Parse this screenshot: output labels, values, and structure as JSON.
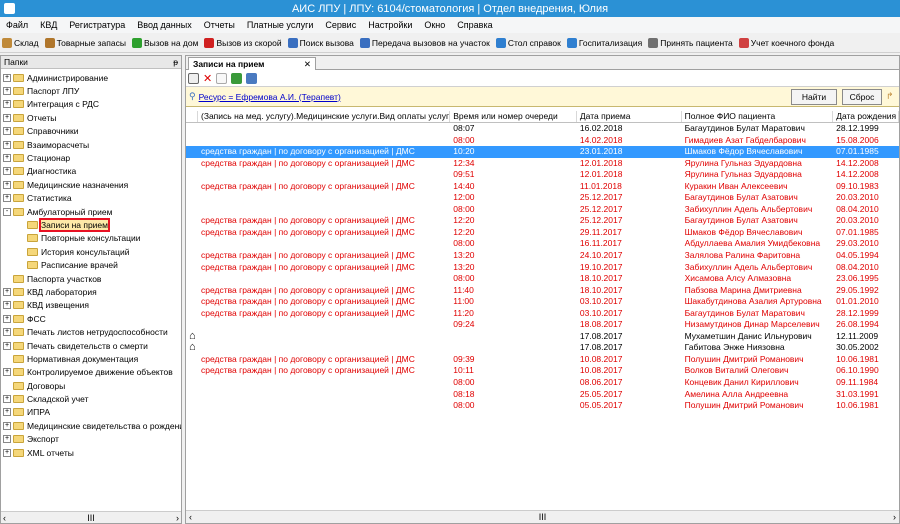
{
  "window": {
    "title": "АИС ЛПУ | ЛПУ: 6104/стоматология | Отдел внедрения, Юлия"
  },
  "menu": [
    "Файл",
    "КВД",
    "Регистратура",
    "Ввод данных",
    "Отчеты",
    "Платные услуги",
    "Сервис",
    "Настройки",
    "Окно",
    "Справка"
  ],
  "toolbar": [
    {
      "label": "Склад",
      "icon": "warehouse-icon",
      "color": "#c08a3a"
    },
    {
      "label": "Товарные запасы",
      "icon": "stock-icon",
      "color": "#b0762b"
    },
    {
      "label": "Вызов на дом",
      "icon": "home-call-icon",
      "color": "#2ea02e"
    },
    {
      "label": "Вызов из скорой",
      "icon": "ambulance-call-icon",
      "color": "#d02020"
    },
    {
      "label": "Поиск вызова",
      "icon": "search-call-icon",
      "color": "#3a6fc0"
    },
    {
      "label": "Передача вызовов на участок",
      "icon": "transfer-call-icon",
      "color": "#3a6fc0"
    },
    {
      "label": "Стол справок",
      "icon": "info-desk-icon",
      "color": "#2f7fd0"
    },
    {
      "label": "Госпитализация",
      "icon": "hospitalization-icon",
      "color": "#2f7fd0"
    },
    {
      "label": "Принять пациента",
      "icon": "accept-patient-icon",
      "color": "#707070"
    },
    {
      "label": "Учет коечного фонда",
      "icon": "bed-fund-icon",
      "color": "#d04040"
    }
  ],
  "left_panel": {
    "title": "Папки",
    "pin": "ᵽ",
    "tree": [
      {
        "label": "Администрирование",
        "level": 0,
        "expander": "+"
      },
      {
        "label": "Паспорт ЛПУ",
        "level": 0,
        "expander": "+"
      },
      {
        "label": "Интеграция с РДС",
        "level": 0,
        "expander": "+"
      },
      {
        "label": "Отчеты",
        "level": 0,
        "expander": "+"
      },
      {
        "label": "Справочники",
        "level": 0,
        "expander": "+"
      },
      {
        "label": "Взаиморасчеты",
        "level": 0,
        "expander": "+"
      },
      {
        "label": "Стационар",
        "level": 0,
        "expander": "+"
      },
      {
        "label": "Диагностика",
        "level": 0,
        "expander": "+"
      },
      {
        "label": "Медицинские назначения",
        "level": 0,
        "expander": "+"
      },
      {
        "label": "Статистика",
        "level": 0,
        "expander": "+"
      },
      {
        "label": "Амбулаторный прием",
        "level": 0,
        "expander": "-"
      },
      {
        "label": "Записи на прием",
        "level": 1,
        "expander": "",
        "selected": true
      },
      {
        "label": "Повторные консультации",
        "level": 1,
        "expander": ""
      },
      {
        "label": "История консультаций",
        "level": 1,
        "expander": ""
      },
      {
        "label": "Расписание врачей",
        "level": 1,
        "expander": ""
      },
      {
        "label": "Паспорта участков",
        "level": 0,
        "expander": ""
      },
      {
        "label": "КВД лаборатория",
        "level": 0,
        "expander": "+"
      },
      {
        "label": "КВД извещения",
        "level": 0,
        "expander": "+"
      },
      {
        "label": "ФСС",
        "level": 0,
        "expander": "+"
      },
      {
        "label": "Печать листов нетрудоспособности",
        "level": 0,
        "expander": "+"
      },
      {
        "label": "Печать свидетельств о смерти",
        "level": 0,
        "expander": "+"
      },
      {
        "label": "Нормативная документация",
        "level": 0,
        "expander": ""
      },
      {
        "label": "Контролируемое движение объектов",
        "level": 0,
        "expander": "+"
      },
      {
        "label": "Договоры",
        "level": 0,
        "expander": ""
      },
      {
        "label": "Складской учет",
        "level": 0,
        "expander": "+"
      },
      {
        "label": "ИПРА",
        "level": 0,
        "expander": "+"
      },
      {
        "label": "Медицинские свидетельства о рождении",
        "level": 0,
        "expander": "+"
      },
      {
        "label": "Экспорт",
        "level": 0,
        "expander": "+"
      },
      {
        "label": "XML отчеты",
        "level": 0,
        "expander": "+"
      }
    ]
  },
  "main": {
    "tab_title": "Записи на прием",
    "tab_close": "✕",
    "filter": "Ресурс = Ефремова А.И. (Терапевт)",
    "find_button": "Найти",
    "reset_button": "Сброс",
    "columns": [
      "",
      "(Запись на мед. услугу).Медицинские услуги.Вид оплаты услуги",
      "Время или номер очереди",
      "Дата приема",
      "Полное ФИО пациента",
      "Дата рождения"
    ],
    "rows": [
      {
        "icon": "",
        "pay": "",
        "time": "08:07",
        "date": "16.02.2018",
        "name": "Багаутдинов Булат Маратович",
        "dob": "28.12.1999",
        "red": false
      },
      {
        "icon": "",
        "pay": "",
        "time": "08:00",
        "date": "14.02.2018",
        "name": "Гимадиев Азат Габделбарович",
        "dob": "15.08.2006",
        "red": true
      },
      {
        "icon": "",
        "pay": "средства граждан | по договору с организацией | ДМС",
        "time": "10:20",
        "date": "23.01.2018",
        "name": "Шмаков Фёдор Вячеславович",
        "dob": "07.01.1985",
        "red": true,
        "selected": true
      },
      {
        "icon": "",
        "pay": "средства граждан | по договору с организацией | ДМС",
        "time": "12:34",
        "date": "12.01.2018",
        "name": "Ярулина Гульназ Эдуардовна",
        "dob": "14.12.2008",
        "red": true
      },
      {
        "icon": "",
        "pay": "",
        "time": "09:51",
        "date": "12.01.2018",
        "name": "Ярулина Гульназ Эдуардовна",
        "dob": "14.12.2008",
        "red": true
      },
      {
        "icon": "",
        "pay": "средства граждан | по договору с организацией | ДМС",
        "time": "14:40",
        "date": "11.01.2018",
        "name": "Куракин Иван Алексеевич",
        "dob": "09.10.1983",
        "red": true
      },
      {
        "icon": "",
        "pay": "",
        "time": "12:00",
        "date": "25.12.2017",
        "name": "Багаутдинов Булат Азатович",
        "dob": "20.03.2010",
        "red": true
      },
      {
        "icon": "",
        "pay": "",
        "time": "08:00",
        "date": "25.12.2017",
        "name": "Забихуллин Адель Альбертович",
        "dob": "08.04.2010",
        "red": true
      },
      {
        "icon": "",
        "pay": "средства граждан | по договору с организацией | ДМС",
        "time": "12:20",
        "date": "25.12.2017",
        "name": "Багаутдинов Булат Азатович",
        "dob": "20.03.2010",
        "red": true
      },
      {
        "icon": "",
        "pay": "средства граждан | по договору с организацией | ДМС",
        "time": "12:20",
        "date": "29.11.2017",
        "name": "Шмаков Фёдор Вячеславович",
        "dob": "07.01.1985",
        "red": true
      },
      {
        "icon": "",
        "pay": "",
        "time": "08:00",
        "date": "16.11.2017",
        "name": "Абдуллаева Амалия Умидбековна",
        "dob": "29.03.2010",
        "red": true
      },
      {
        "icon": "",
        "pay": "средства граждан | по договору с организацией | ДМС",
        "time": "13:20",
        "date": "24.10.2017",
        "name": "Залялова Ралина Фаритовна",
        "dob": "04.05.1994",
        "red": true
      },
      {
        "icon": "",
        "pay": "средства граждан | по договору с организацией | ДМС",
        "time": "13:20",
        "date": "19.10.2017",
        "name": "Забихуллин Адель Альбертович",
        "dob": "08.04.2010",
        "red": true
      },
      {
        "icon": "",
        "pay": "",
        "time": "08:00",
        "date": "18.10.2017",
        "name": "Хисамова Алсу Алмазовна",
        "dob": "23.06.1995",
        "red": true
      },
      {
        "icon": "",
        "pay": "средства граждан | по договору с организацией | ДМС",
        "time": "11:40",
        "date": "18.10.2017",
        "name": "Пабзова Марина Дмитриевна",
        "dob": "29.05.1992",
        "red": true
      },
      {
        "icon": "",
        "pay": "средства граждан | по договору с организацией | ДМС",
        "time": "11:00",
        "date": "03.10.2017",
        "name": "Шакабутдинова Азалия Артуровна",
        "dob": "01.01.2010",
        "red": true
      },
      {
        "icon": "",
        "pay": "средства граждан | по договору с организацией | ДМС",
        "time": "11:20",
        "date": "03.10.2017",
        "name": "Багаутдинов Булат Маратович",
        "dob": "28.12.1999",
        "red": true
      },
      {
        "icon": "",
        "pay": "",
        "time": "09:24",
        "date": "18.08.2017",
        "name": "Низамутдинов Динар Марселевич",
        "dob": "26.08.1994",
        "red": true
      },
      {
        "icon": "home-icon",
        "pay": "",
        "time": "",
        "date": "17.08.2017",
        "name": "Мухаметшин Данис Ильнурович",
        "dob": "12.11.2009",
        "red": false
      },
      {
        "icon": "home-icon",
        "pay": "",
        "time": "",
        "date": "17.08.2017",
        "name": "Габитова Энже Ниязовна",
        "dob": "30.05.2002",
        "red": false
      },
      {
        "icon": "",
        "pay": "средства граждан | по договору с организацией | ДМС",
        "time": "09:39",
        "date": "10.08.2017",
        "name": "Полушин Дмитрий Романович",
        "dob": "10.06.1981",
        "red": true
      },
      {
        "icon": "",
        "pay": "средства граждан | по договору с организацией | ДМС",
        "time": "10:11",
        "date": "10.08.2017",
        "name": "Волков Виталий Олегович",
        "dob": "06.10.1990",
        "red": true
      },
      {
        "icon": "",
        "pay": "",
        "time": "08:00",
        "date": "08.06.2017",
        "name": "Концевик Данил Кириллович",
        "dob": "09.11.1984",
        "red": true
      },
      {
        "icon": "",
        "pay": "",
        "time": "08:18",
        "date": "25.05.2017",
        "name": "Амелина Алла Андреевна",
        "dob": "31.03.1991",
        "red": true
      },
      {
        "icon": "",
        "pay": "",
        "time": "08:00",
        "date": "05.05.2017",
        "name": "Полушин Дмитрий Романович",
        "dob": "10.06.1981",
        "red": true
      }
    ],
    "scroll_mark": "III"
  },
  "colors": {
    "titlebar": "#2b91d5",
    "selection": "#3399ff",
    "red_text": "#e00000",
    "filter_bg": "#fff8d8"
  }
}
